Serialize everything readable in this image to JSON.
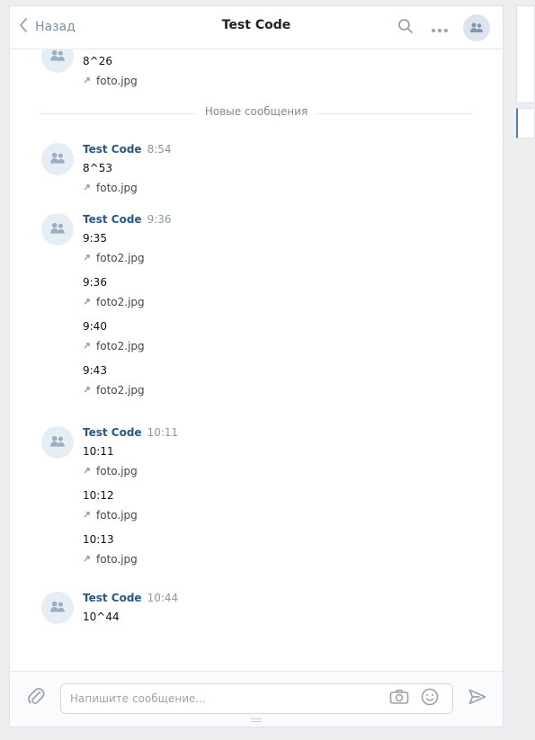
{
  "header": {
    "back_label": "Назад",
    "title": "Test Code"
  },
  "separator": {
    "label": "Новые сообщения"
  },
  "composer": {
    "placeholder": "Напишите сообщение..."
  },
  "icons": {
    "back": "chevron-left-icon",
    "search": "search-icon",
    "more": "more-icon",
    "chat_avatar": "people-icon",
    "attachment": "paperclip-icon",
    "camera": "camera-icon",
    "emoji": "emoji-icon",
    "send": "send-icon",
    "file_link": "file-link-icon"
  },
  "messages": [
    {
      "author": "",
      "time": "",
      "items": [
        {
          "text": "8^26",
          "attachment": "foto.jpg"
        }
      ]
    },
    {
      "author": "Test Code",
      "time": "8:54",
      "items": [
        {
          "text": "8^53",
          "attachment": "foto.jpg"
        }
      ]
    },
    {
      "author": "Test Code",
      "time": "9:36",
      "items": [
        {
          "text": "9:35",
          "attachment": "foto2.jpg"
        },
        {
          "text": "9:36",
          "attachment": "foto2.jpg"
        },
        {
          "text": "9:40",
          "attachment": "foto2.jpg"
        },
        {
          "text": "9:43",
          "attachment": "foto2.jpg"
        }
      ]
    },
    {
      "author": "Test Code",
      "time": "10:11",
      "items": [
        {
          "text": "10:11",
          "attachment": "foto.jpg"
        },
        {
          "text": "10:12",
          "attachment": "foto.jpg"
        },
        {
          "text": "10:13",
          "attachment": "foto.jpg"
        }
      ]
    },
    {
      "author": "Test Code",
      "time": "10:44",
      "items": [
        {
          "text": "10^44",
          "attachment": ""
        }
      ]
    }
  ],
  "colors": {
    "accent": "#5181b8",
    "author": "#2a5885",
    "muted": "#8b97a5",
    "background": "#edeef0"
  }
}
